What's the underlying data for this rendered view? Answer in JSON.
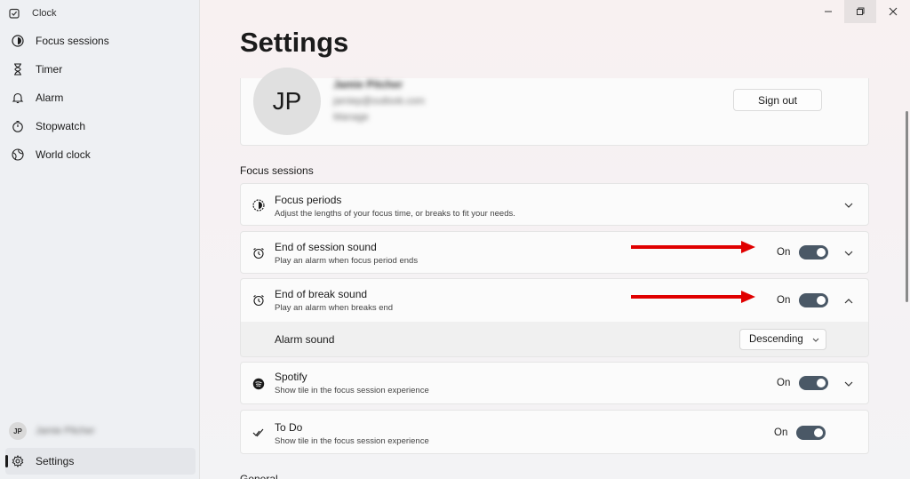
{
  "app": {
    "title": "Clock"
  },
  "sidebar": {
    "items": [
      {
        "label": "Focus sessions",
        "icon": "focus-icon"
      },
      {
        "label": "Timer",
        "icon": "hourglass-icon"
      },
      {
        "label": "Alarm",
        "icon": "bell-icon"
      },
      {
        "label": "Stopwatch",
        "icon": "stopwatch-icon"
      },
      {
        "label": "World clock",
        "icon": "globe-icon"
      }
    ],
    "user": {
      "initials": "JP",
      "name": "Jamie Pitcher"
    },
    "settings": {
      "label": "Settings",
      "icon": "gear-icon"
    }
  },
  "main": {
    "title": "Settings",
    "profile": {
      "initials": "JP",
      "name": "Jamie Pitcher",
      "email": "jamiep@outlook.com",
      "manage": "Manage",
      "sign_out": "Sign out"
    },
    "section": "Focus sessions",
    "cards": [
      {
        "title": "Focus periods",
        "subtitle": "Adjust the lengths of your focus time, or breaks to fit your needs."
      },
      {
        "title": "End of session sound",
        "subtitle": "Play an alarm when focus period ends",
        "state": "On"
      },
      {
        "title": "End of break sound",
        "subtitle": "Play an alarm when breaks end",
        "state": "On"
      },
      {
        "title": "Spotify",
        "subtitle": "Show tile in the focus session experience",
        "state": "On"
      },
      {
        "title": "To Do",
        "subtitle": "Show tile in the focus session experience",
        "state": "On"
      }
    ],
    "alarm_sound": {
      "label": "Alarm sound",
      "value": "Descending"
    },
    "next_section_peek": "General"
  },
  "colors": {
    "toggle_on": "#4a5866",
    "annotation_arrow": "#e00000"
  }
}
